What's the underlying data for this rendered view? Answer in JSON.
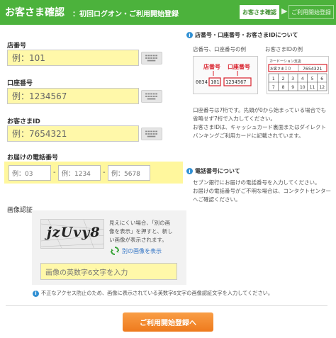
{
  "header": {
    "title": "お客さま確認",
    "subtitle": "：初回ログオン・ご利用開始登録",
    "step_current": "お客さま確認",
    "step_arrow": "▶",
    "step_next": "ご利用開始登録"
  },
  "form": {
    "branch_label": "店番号",
    "branch_placeholder": "例：101",
    "account_label": "口座番号",
    "account_placeholder": "例：1234567",
    "customer_id_label": "お客さまID",
    "customer_id_placeholder": "例：7654321",
    "phone_label": "お届けの電話番号",
    "phone_placeholder_1": "例：03",
    "phone_placeholder_2": "例：1234",
    "phone_placeholder_3": "例：5678",
    "phone_dash": "-"
  },
  "side": {
    "branch_title": "店番号・口座番号・お客さまIDについて",
    "example_left_caption": "店番号、口座番号の例",
    "example_right_caption": "お客さまIDの例",
    "example_branch_tag": "店番号",
    "example_account_tag": "口座番号",
    "example_branch_value": "101",
    "example_account_value": "1234567",
    "example_prefix": "0034",
    "card_header": "カードーション支店",
    "card_id_label": "お客さまＩＤ",
    "card_id_value": "7654321",
    "card_row1": [
      "1",
      "2",
      "3",
      "4",
      "5",
      "6"
    ],
    "card_row2": [
      "7",
      "8",
      "9",
      "10",
      "11",
      "12"
    ],
    "branch_text_1": "口座番号は7桁です。先頭が0から始まっている場合でも",
    "branch_text_2": "省略せず7桁で入力してください。",
    "branch_text_3": "お客さまIDは、キャッシュカード裏面またはダイレクト",
    "branch_text_4": "バンキングご利用カードに記載されています。",
    "phone_title": "電話番号について",
    "phone_text_1": "セブン銀行にお届けの電話番号を入力してください。",
    "phone_text_2": "お届けの電話番号がご不明な場合は、コンタクトセンター",
    "phone_text_3": "へご確認ください。"
  },
  "captcha": {
    "label": "画像認証",
    "image_text": "jzUvy8",
    "hint_1": "見えにくい場合、「別の画",
    "hint_2": "像を表示」を押すと、新し",
    "hint_3": "い画像が表示されます。",
    "refresh_label": "別の画像を表示",
    "input_placeholder": "画像の英数字6文字を入力",
    "note": "不正なアクセス防止のため、画像に表示されている英数字6文字の画像認証文字を入力してください。"
  },
  "submit_label": "ご利用開始登録へ",
  "colors": {
    "header_green": "#4cb23c",
    "input_yellow": "#fff8a9",
    "button_orange": "#f28a2e",
    "info_blue": "#2f8fd3",
    "example_red": "#d9212c"
  },
  "icons": {
    "keyboard": "keyboard-icon",
    "info": "info-icon",
    "refresh": "refresh-icon"
  }
}
